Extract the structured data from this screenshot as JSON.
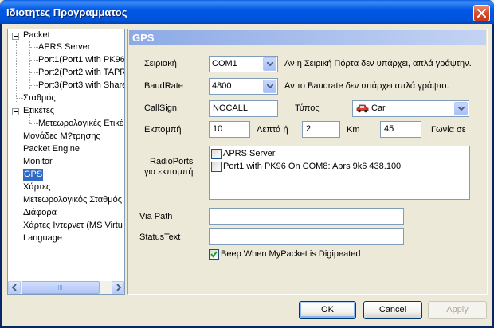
{
  "window": {
    "title": "Ιδιοτητες Προγραμματος"
  },
  "tree": {
    "items": [
      {
        "label": "Packet"
      },
      {
        "label": "APRS Server"
      },
      {
        "label": "Port1(Port1 with PK96"
      },
      {
        "label": "Port2(Port2 with TAPR"
      },
      {
        "label": "Port3(Port3 with Share"
      },
      {
        "label": "Σταθμός"
      },
      {
        "label": "Ετικέτες"
      },
      {
        "label": "Μετεωρολογικές Ετικέ"
      },
      {
        "label": "Μονάδες Μ?τρησης"
      },
      {
        "label": "Packet Engine"
      },
      {
        "label": "Monitor"
      },
      {
        "label": "GPS",
        "selected": true
      },
      {
        "label": "Χάρτες"
      },
      {
        "label": "Μετεωρολογικός Σταθμός"
      },
      {
        "label": "Διάφορα"
      },
      {
        "label": "Χάρτες Ιντερνετ (MS Virtu"
      },
      {
        "label": "Language"
      }
    ]
  },
  "panel": {
    "title": "GPS",
    "serial": {
      "label": "Σειριακή",
      "value": "COM1",
      "hint": "Αν η Σειρική Πόρτα δεν υπάρχει, απλά γράψτην."
    },
    "baud": {
      "label": "BaudRate",
      "value": "4800",
      "hint": "Αν το Baudrate δεν υπάρχει απλά γράψτο."
    },
    "callsign": {
      "label": "CallSign",
      "value": "NOCALL"
    },
    "type": {
      "label": "Τύπος",
      "value": "Car",
      "icon": "car-icon"
    },
    "emission": {
      "label": "Εκπομπή",
      "minutes": "10",
      "minutes_label": "Λεπτά ή",
      "km": "2",
      "km_label": "Km",
      "angle": "45",
      "angle_label": "Γωνία σε"
    },
    "radioports": {
      "label_line1": "RadioPorts",
      "label_line2": "για εκπομπή",
      "items": [
        {
          "label": "APRS Server",
          "checked": false
        },
        {
          "label": "Port1 with PK96 On COM8: Aprs 9k6 438.100",
          "checked": false
        }
      ]
    },
    "via_path": {
      "label": "Via Path",
      "value": ""
    },
    "status_text": {
      "label": "StatusText",
      "value": ""
    },
    "beep": {
      "label": "Beep When MyPacket is Digipeated",
      "checked": true
    }
  },
  "buttons": {
    "ok": "OK",
    "cancel": "Cancel",
    "apply": "Apply"
  },
  "colors": {
    "titlebar": "#0055E5",
    "selection": "#316AC5",
    "face": "#ECE9D8",
    "panel_header": "#8CAAE6"
  }
}
